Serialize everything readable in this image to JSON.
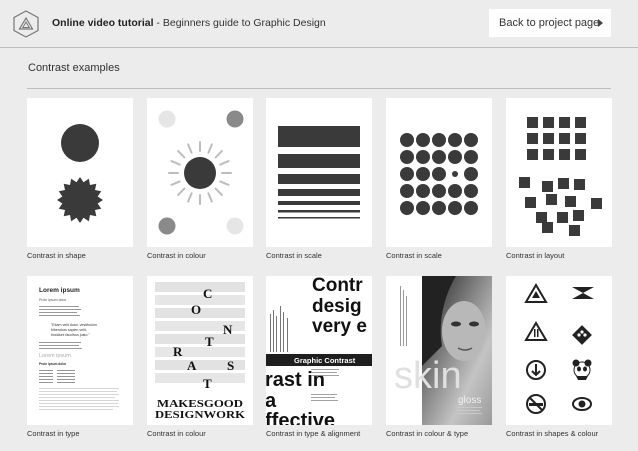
{
  "header": {
    "logo_icon": "triangle-hexagon-logo-icon",
    "title_bold": "Online video tutorial",
    "title_separator": " - ",
    "title_rest": "Beginners guide to Graphic Design",
    "back_button_label": "Back to project page",
    "back_button_icon": "caret-right-icon"
  },
  "section": {
    "title": "Contrast examples"
  },
  "cards": [
    {
      "caption": "Contrast in shape"
    },
    {
      "caption": "Contrast in colour"
    },
    {
      "caption": "Contrast in scale"
    },
    {
      "caption": "Contrast in scale"
    },
    {
      "caption": "Contrast in layout"
    },
    {
      "caption": "Contrast in type",
      "texts": {
        "h1": "Lorem ipsum",
        "s1": "Proin ipsum dolor",
        "q1": "\"Etiam velit dolor, vestibulum",
        "q2": "bibendum sapien velit,",
        "q3": "tincidunt faucibus justo.\"",
        "h2": "Lorem ipsum",
        "s2": "Proin ipsum dolor"
      }
    },
    {
      "caption": "Contrast in colour",
      "texts": {
        "l1": "MAKESGOOD",
        "l2": "DESIGNWORK",
        "c": "C",
        "o": "O",
        "n": "N",
        "t1": "T",
        "r": "R",
        "a": "A",
        "s": "S",
        "t2": "T"
      }
    },
    {
      "caption": "Contrast in type & alignment",
      "texts": {
        "b1": "Contr",
        "b2": "desig",
        "b3": "very e",
        "band": "Graphic Contrast",
        "b4": "rast in",
        "b5": "a",
        "b6": "ffective"
      }
    },
    {
      "caption": "Contrast in colour & type",
      "texts": {
        "word": "skin",
        "sub": "gloss"
      }
    },
    {
      "caption": "Contrast in shapes & colour"
    }
  ]
}
